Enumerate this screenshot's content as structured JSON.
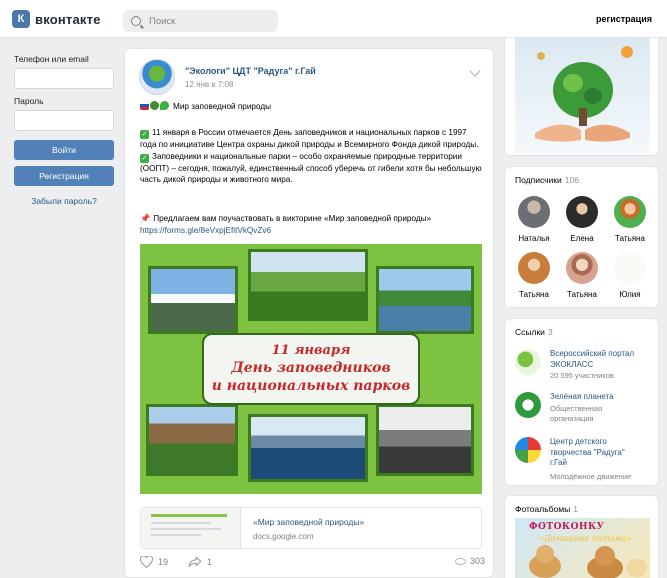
{
  "header": {
    "logo_letter": "К",
    "logo_text": "вконтакте",
    "search_placeholder": "Поиск",
    "register_link": "регистрация"
  },
  "login": {
    "phone_label": "Телефон или email",
    "password_label": "Пароль",
    "login_button": "Войти",
    "register_button": "Регистрация",
    "forgot_link": "Забыли пароль?"
  },
  "post": {
    "group_name": "\"Экологи\" ЦДТ \"Радуга\" г.Гай",
    "date": "12 янв в 7:08",
    "headline": "Мир заповедной природы",
    "para1": "11 января в России отмечается День заповедников и национальных парков с 1997 года по инициативе Центра охраны дикой природы и Всемирного Фонда дикой природы.",
    "para2": "Заповедники и национальные парки – особо охраняемые природные территории (ООПТ) – сегодня, пожалуй, единственный способ уберечь от гибели хотя бы небольшую часть дикой природы и животного мира.",
    "para3": "Предлагаем вам поучаствовать в викторине «Мир заповедной природы»",
    "url": "https://forms.gle/8eVxpjEfitVkQvZv6",
    "poster_line1": "11 января",
    "poster_line2": "День заповедников",
    "poster_line3": "и национальных парков",
    "preview_title": "«Мир заповедной природы»",
    "preview_url": "docs.google.com",
    "likes": "19",
    "shares": "1",
    "views": "303"
  },
  "subscribers": {
    "title": "Подписчики",
    "count": "106",
    "people": [
      {
        "name": "Наталья",
        "color": "#6b6f73"
      },
      {
        "name": "Елена",
        "color": "#2b2b2b"
      },
      {
        "name": "Татьяна",
        "color": "#4caf50"
      },
      {
        "name": "Татьяна",
        "color": "#c87d3a"
      },
      {
        "name": "Татьяна",
        "color": "#d7a38c"
      },
      {
        "name": "Юлия",
        "color": "#fbfaf6"
      }
    ]
  },
  "links": {
    "title": "Ссылки",
    "count": "3",
    "items": [
      {
        "name": "Всероссийский портал ЭКОКЛАСС",
        "desc": "20 595 участников"
      },
      {
        "name": "Зелёная планета",
        "desc": "Общественная организация"
      },
      {
        "name": "Центр детского творчества \"Радуга\" г.Гай",
        "desc": "Молодёжное движение"
      }
    ]
  },
  "albums": {
    "title": "Фотоальбомы",
    "count": "1",
    "cover_text": "ФОТОКОНКУ",
    "cover_sub": "«Домашние питомц»"
  },
  "colors": {
    "brand": "#4a76a8",
    "button": "#5181b8",
    "link": "#2a5885",
    "poster_green": "#7dc241",
    "poster_text": "#c62828"
  }
}
